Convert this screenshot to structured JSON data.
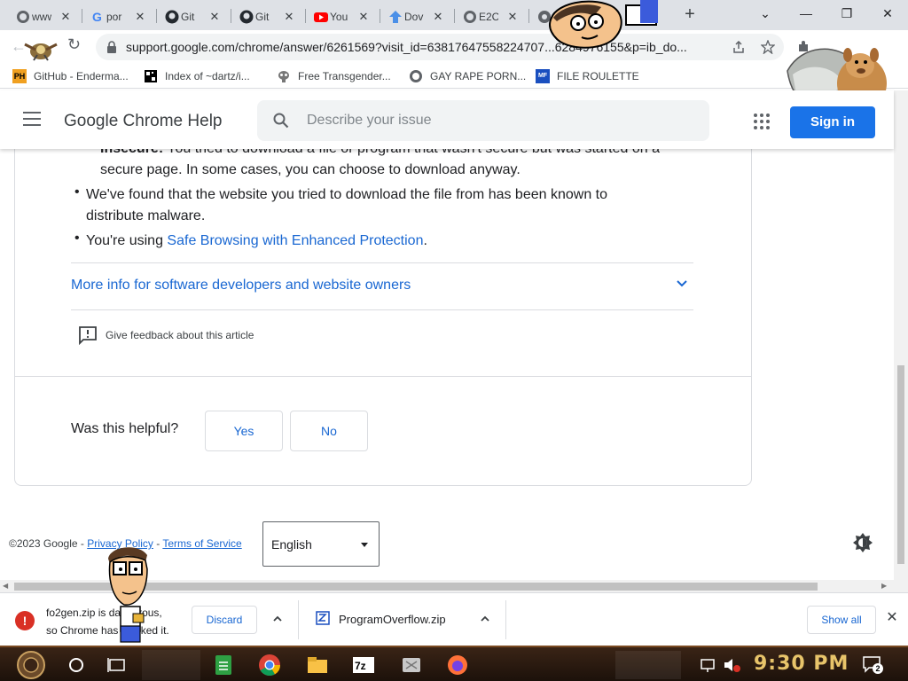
{
  "browser": {
    "tabs": [
      {
        "title": "www",
        "icon": "globe-icon"
      },
      {
        "title": "por",
        "icon": "google-icon"
      },
      {
        "title": "Git",
        "icon": "github-icon"
      },
      {
        "title": "Git",
        "icon": "github-icon"
      },
      {
        "title": "You",
        "icon": "youtube-icon"
      },
      {
        "title": "Dov",
        "icon": "upload-arrow-icon"
      },
      {
        "title": "E2C",
        "icon": "globe-icon"
      },
      {
        "title": "",
        "icon": "chrome-icon"
      }
    ],
    "new_tab_label": "+",
    "url": "support.google.com/chrome/answer/6261569?visit_id=63817647558224707...6284976155&p=ib_do...",
    "bookmarks": [
      {
        "label": "GitHub - Enderma...",
        "icon": "ph-icon",
        "icon_text": "PH"
      },
      {
        "label": "Index of ~dartz/i...",
        "icon": "qr-icon",
        "icon_text": ""
      },
      {
        "label": "Free Transgender...",
        "icon": "mask-icon",
        "icon_text": ""
      },
      {
        "label": "GAY RAPE PORN...",
        "icon": "globe-icon",
        "icon_text": ""
      },
      {
        "label": "FILE ROULETTE",
        "icon": "mf-icon",
        "icon_text": "MF"
      }
    ]
  },
  "help_header": {
    "title": "Google Chrome Help",
    "search_placeholder": "Describe your issue",
    "signin_label": "Sign in"
  },
  "article": {
    "insecure_bold": "Insecure:",
    "insecure_line1": " You tried to download a file or program that wasn't secure but was started on a",
    "insecure_line2": "secure page. In some cases, you can choose to download anyway.",
    "malware_line1": "We've found that the website you tried to download the file from has been known to",
    "malware_line2": "distribute malware.",
    "safe_prefix": "You're using ",
    "safe_link": "Safe Browsing with Enhanced Protection",
    "safe_suffix": ".",
    "more_info": "More info for software developers and website owners",
    "feedback": "Give feedback about this article"
  },
  "helpful": {
    "question": "Was this helpful?",
    "yes": "Yes",
    "no": "No"
  },
  "footer": {
    "copyright": "©2023 Google - ",
    "privacy": "Privacy Policy",
    "sep": " - ",
    "terms": "Terms of Service",
    "language": "English"
  },
  "downloads": {
    "item1_line1": "fo2gen.zip is dangerous,",
    "item1_line2": "so Chrome has blocked it.",
    "discard": "Discard",
    "item2": "ProgramOverflow.zip",
    "show_all": "Show all"
  },
  "taskbar": {
    "clock": "9:30 PM",
    "notification_count": "2"
  },
  "colors": {
    "accent": "#1a73e8",
    "link": "#1967d2",
    "danger": "#d93025"
  }
}
